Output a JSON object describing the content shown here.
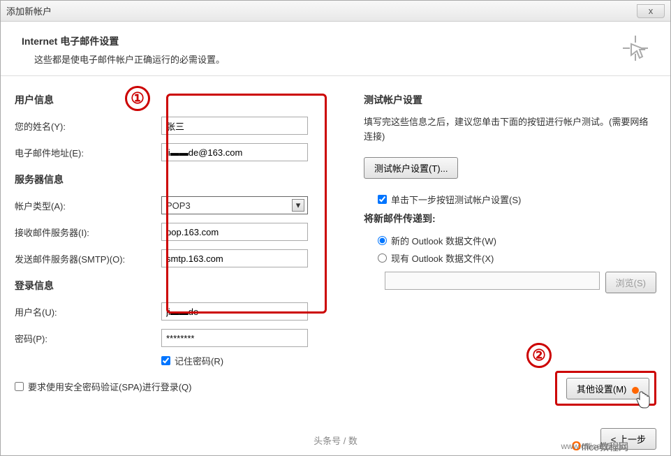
{
  "window": {
    "title": "添加新帐户",
    "close": "x"
  },
  "header": {
    "title": "Internet 电子邮件设置",
    "subtitle": "这些都是使电子邮件帐户正确运行的必需设置。"
  },
  "annotations": {
    "one": "①",
    "two": "②"
  },
  "left": {
    "user_section": "用户信息",
    "name_label": "您的姓名(Y):",
    "name_value": "张三",
    "email_label": "电子邮件地址(E):",
    "email_value": "ji▬▬de@163.com",
    "server_section": "服务器信息",
    "type_label": "帐户类型(A):",
    "type_value": "POP3",
    "incoming_label": "接收邮件服务器(I):",
    "incoming_value": "pop.163.com",
    "outgoing_label": "发送邮件服务器(SMTP)(O):",
    "outgoing_value": "smtp.163.com",
    "login_section": "登录信息",
    "user_label": "用户名(U):",
    "user_value": "ji▬▬de",
    "pass_label": "密码(P):",
    "pass_value": "********",
    "remember_label": "记住密码(R)",
    "spa_label": "要求使用安全密码验证(SPA)进行登录(Q)"
  },
  "right": {
    "test_section": "测试帐户设置",
    "test_text": "填写完这些信息之后，建议您单击下面的按钮进行帐户测试。(需要网络连接)",
    "test_button": "测试帐户设置(T)...",
    "auto_test_label": "单击下一步按钮测试帐户设置(S)",
    "deliver_section": "将新邮件传递到:",
    "radio_new": "新的 Outlook 数据文件(W)",
    "radio_existing": "现有 Outlook 数据文件(X)",
    "browse_button": "浏览(S)",
    "other_button": "其他设置(M)"
  },
  "footer": {
    "back": "< 上一步",
    "watermark1": "头条号 / 数",
    "watermark2": "www.office26.com",
    "logo_o": "O",
    "logo_rest": "ffice教程网"
  }
}
